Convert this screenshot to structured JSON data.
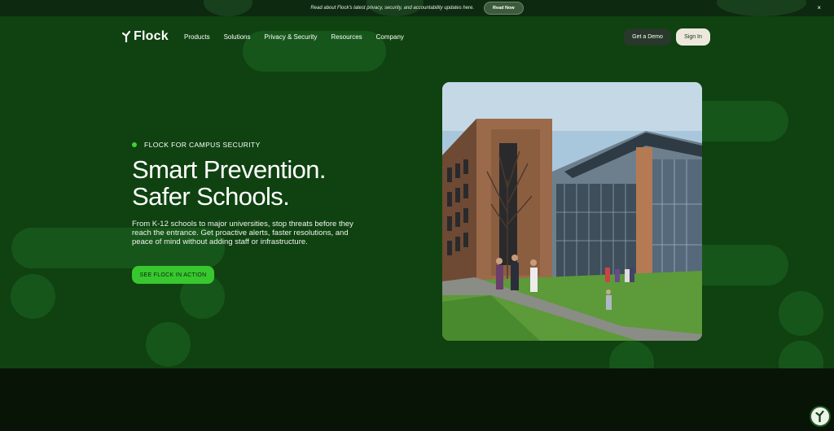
{
  "announcement": {
    "text": "Read about Flock's latest privacy, security, and accountability updates here.",
    "button_label": "Read Now",
    "close_label": "×"
  },
  "nav": {
    "logo_text": "Flock",
    "links": [
      "Products",
      "Solutions",
      "Privacy & Security",
      "Resources",
      "Company"
    ],
    "demo_label": "Get a Demo",
    "signin_label": "Sign In"
  },
  "hero": {
    "eyebrow": "FLOCK FOR CAMPUS SECURITY",
    "headline_line1": "Smart Prevention.",
    "headline_line2": "Safer Schools.",
    "subtext": "From K-12 schools to major universities, stop threats before they reach the entrance. Get proactive alerts, faster resolutions, and peace of mind without adding staff or infrastructure.",
    "cta_label": "SEE FLOCK IN ACTION"
  },
  "colors": {
    "hero_bg": "#0f4210",
    "accent_green": "#38c72f",
    "signin_bg": "#ece8dc"
  },
  "icons": [
    "flock-logo-icon",
    "close-icon",
    "chat-widget-icon"
  ]
}
